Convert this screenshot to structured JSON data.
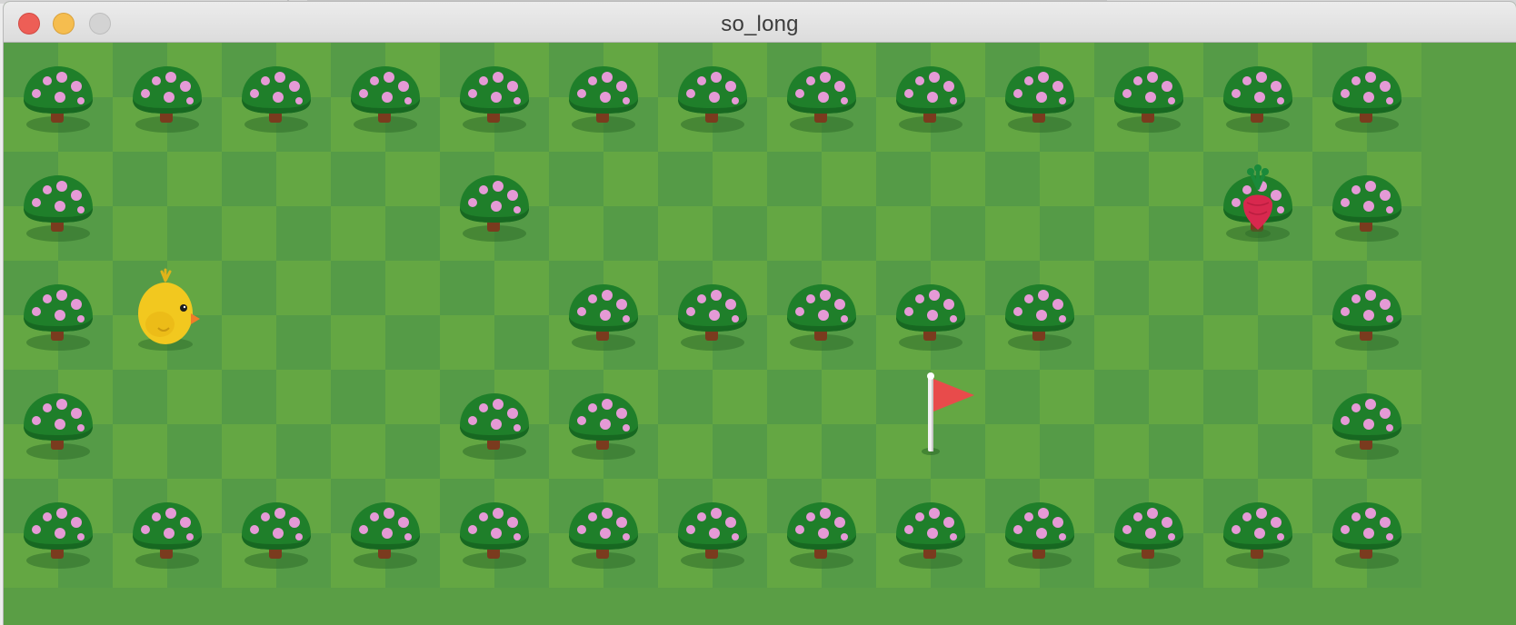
{
  "window": {
    "title": "so_long",
    "controls": [
      "close",
      "minimize",
      "zoom"
    ]
  },
  "colors": {
    "grass_light": "#64a743",
    "grass_dark": "#559b47",
    "tree_foliage": "#1f7f2a",
    "tree_foliage_dark": "#176821",
    "tree_spots": "#e59ad6",
    "tree_trunk": "#7a3b1e",
    "player_body": "#f2c81f",
    "player_beak": "#f07c2a",
    "collectible_red": "#d8284e",
    "collectible_leaf": "#1a8a3a",
    "flag_red": "#e84b4b",
    "flag_pole": "#f2f2f2"
  },
  "map": {
    "rows": [
      "1111111111111",
      "1000100000011",
      "1P00011111001",
      "1000110000001",
      "1111111111111"
    ],
    "legend": {
      "1": "wall-tree",
      "0": "grass",
      "P": "player-chick",
      "C": "collectible-radish",
      "E": "exit-flag"
    },
    "collectible": {
      "row": 1,
      "col": 11
    },
    "exit": {
      "row": 3,
      "col": 8
    },
    "player": {
      "row": 2,
      "col": 1
    }
  }
}
